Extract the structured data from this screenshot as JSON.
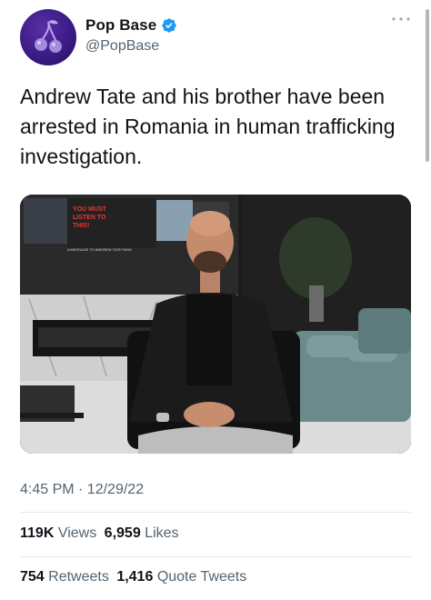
{
  "author": {
    "display_name": "Pop Base",
    "handle": "@PopBase"
  },
  "tweet": {
    "text": "Andrew Tate and his brother have been arrested in Romania in human trafficking investigation."
  },
  "media": {
    "screen_text_1": "YOU MUST LISTEN TO THIS!",
    "screen_text_2": "A MESSAGE TO ANDREW TATE FANS"
  },
  "meta": {
    "timestamp": "4:45 PM · 12/29/22"
  },
  "stats": {
    "views_count": "119K",
    "views_label": "Views",
    "likes_count": "6,959",
    "likes_label": "Likes",
    "retweets_count": "754",
    "retweets_label": "Retweets",
    "quotes_count": "1,416",
    "quotes_label": "Quote Tweets"
  },
  "colors": {
    "verified": "#1d9bf0",
    "secondary_text": "#536471",
    "avatar_purple": "#3b1c86"
  },
  "icons": [
    "avatar-cherry-icon",
    "verified-badge-icon",
    "more-options-icon"
  ]
}
